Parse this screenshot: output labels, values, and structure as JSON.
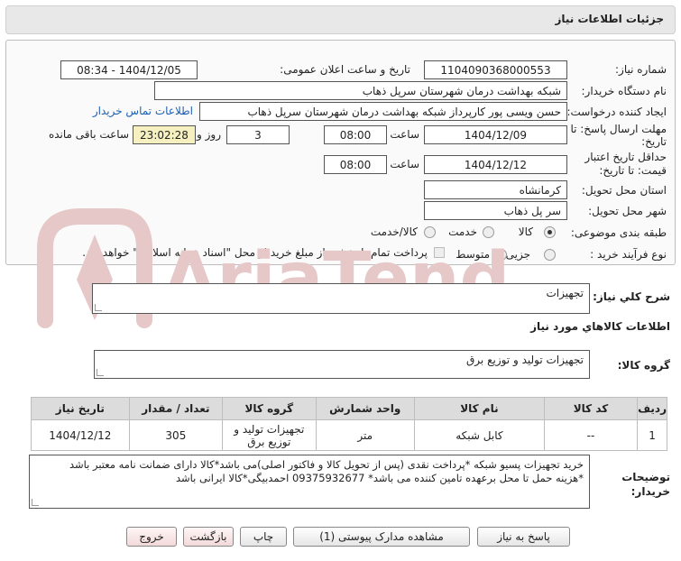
{
  "header": {
    "title": "جزئیات اطلاعات نیاز"
  },
  "fields": {
    "need_number_label": "شماره نیاز:",
    "need_number": "1104090368000553",
    "announce_label": "تاریخ و ساعت اعلان عمومی:",
    "announce_value": "1404/12/05 - 08:34",
    "buyer_org_label": "نام دستگاه خریدار:",
    "buyer_org": "شبکه بهداشت درمان شهرستان سرپل ذهاب",
    "creator_label": "ایجاد کننده درخواست:",
    "creator": "حسن ویسی پور کارپرداز شبکه بهداشت درمان شهرستان سرپل ذهاب",
    "contact_link": "اطلاعات تماس خریدار",
    "deadline_label_1": "مهلت ارسال پاسخ: تا",
    "deadline_label_2": "تاریخ:",
    "deadline_date": "1404/12/09",
    "time_label": "ساعت",
    "deadline_time": "08:00",
    "days_value": "3",
    "days_label": "روز و",
    "remaining_time": "23:02:28",
    "remaining_label": "ساعت باقی مانده",
    "validity_label_1": "حداقل تاریخ اعتبار",
    "validity_label_2": "قیمت: تا تاریخ:",
    "validity_date": "1404/12/12",
    "validity_time": "08:00",
    "province_label": "استان محل تحویل:",
    "province": "کرمانشاه",
    "city_label": "شهر محل تحویل:",
    "city": "سر پل ذهاب",
    "category_label": "طبقه بندی موضوعی:",
    "category_options": [
      "کالا",
      "خدمت",
      "کالا/خدمت"
    ],
    "process_label": "نوع فرآیند خرید :",
    "process_options": [
      "جزیی",
      "متوسط"
    ],
    "treasury_note": "پرداخت تمام یا بخشی از مبلغ خرید،از محل \"اسناد خزانه اسلامی\" خواهد بود."
  },
  "description": {
    "label": "شرح كلي نياز:",
    "value": "تجهیزات"
  },
  "goods_info": {
    "title": "اطلاعات كالاهاي مورد نياز",
    "group_label": "گروه کالا:",
    "group_value": "تجهیزات تولید و توزیع برق"
  },
  "table": {
    "headers": [
      "ردیف",
      "کد کالا",
      "نام کالا",
      "واحد شمارش",
      "گروه کالا",
      "تعداد / مقدار",
      "تاریخ نیاز"
    ],
    "rows": [
      {
        "index": "1",
        "code": "--",
        "name": "کابل شبکه",
        "unit": "متر",
        "group": "تجهیزات تولید و توزیع برق",
        "qty": "305",
        "date": "1404/12/12"
      }
    ]
  },
  "buyer_notes": {
    "label_1": "توضیحات",
    "label_2": "خریدار:",
    "line_1": "خرید تجهیزات پسیو شبکه *پرداخت نقدی (پس از تحویل کالا و فاکتور اصلی)می باشد*کالا دارای ضمانت نامه معتبر باشد",
    "line_2": "*هزینه حمل تا محل برعهده تامین کننده می باشد* 09375932677 احمدبیگی*کالا ایرانی باشد"
  },
  "buttons": {
    "reply": "پاسخ به نیاز",
    "attachments": "مشاهده مدارک پیوستی (1)",
    "print": "چاپ",
    "back": "بازگشت",
    "exit": "خروج"
  },
  "watermark": {
    "text": "AriaTender.neT",
    "color": "#e6c8c8"
  },
  "colors": {
    "link": "#1a5fb4",
    "highlight": "#f6f0c0",
    "header_bg": "#e8e8e8"
  }
}
